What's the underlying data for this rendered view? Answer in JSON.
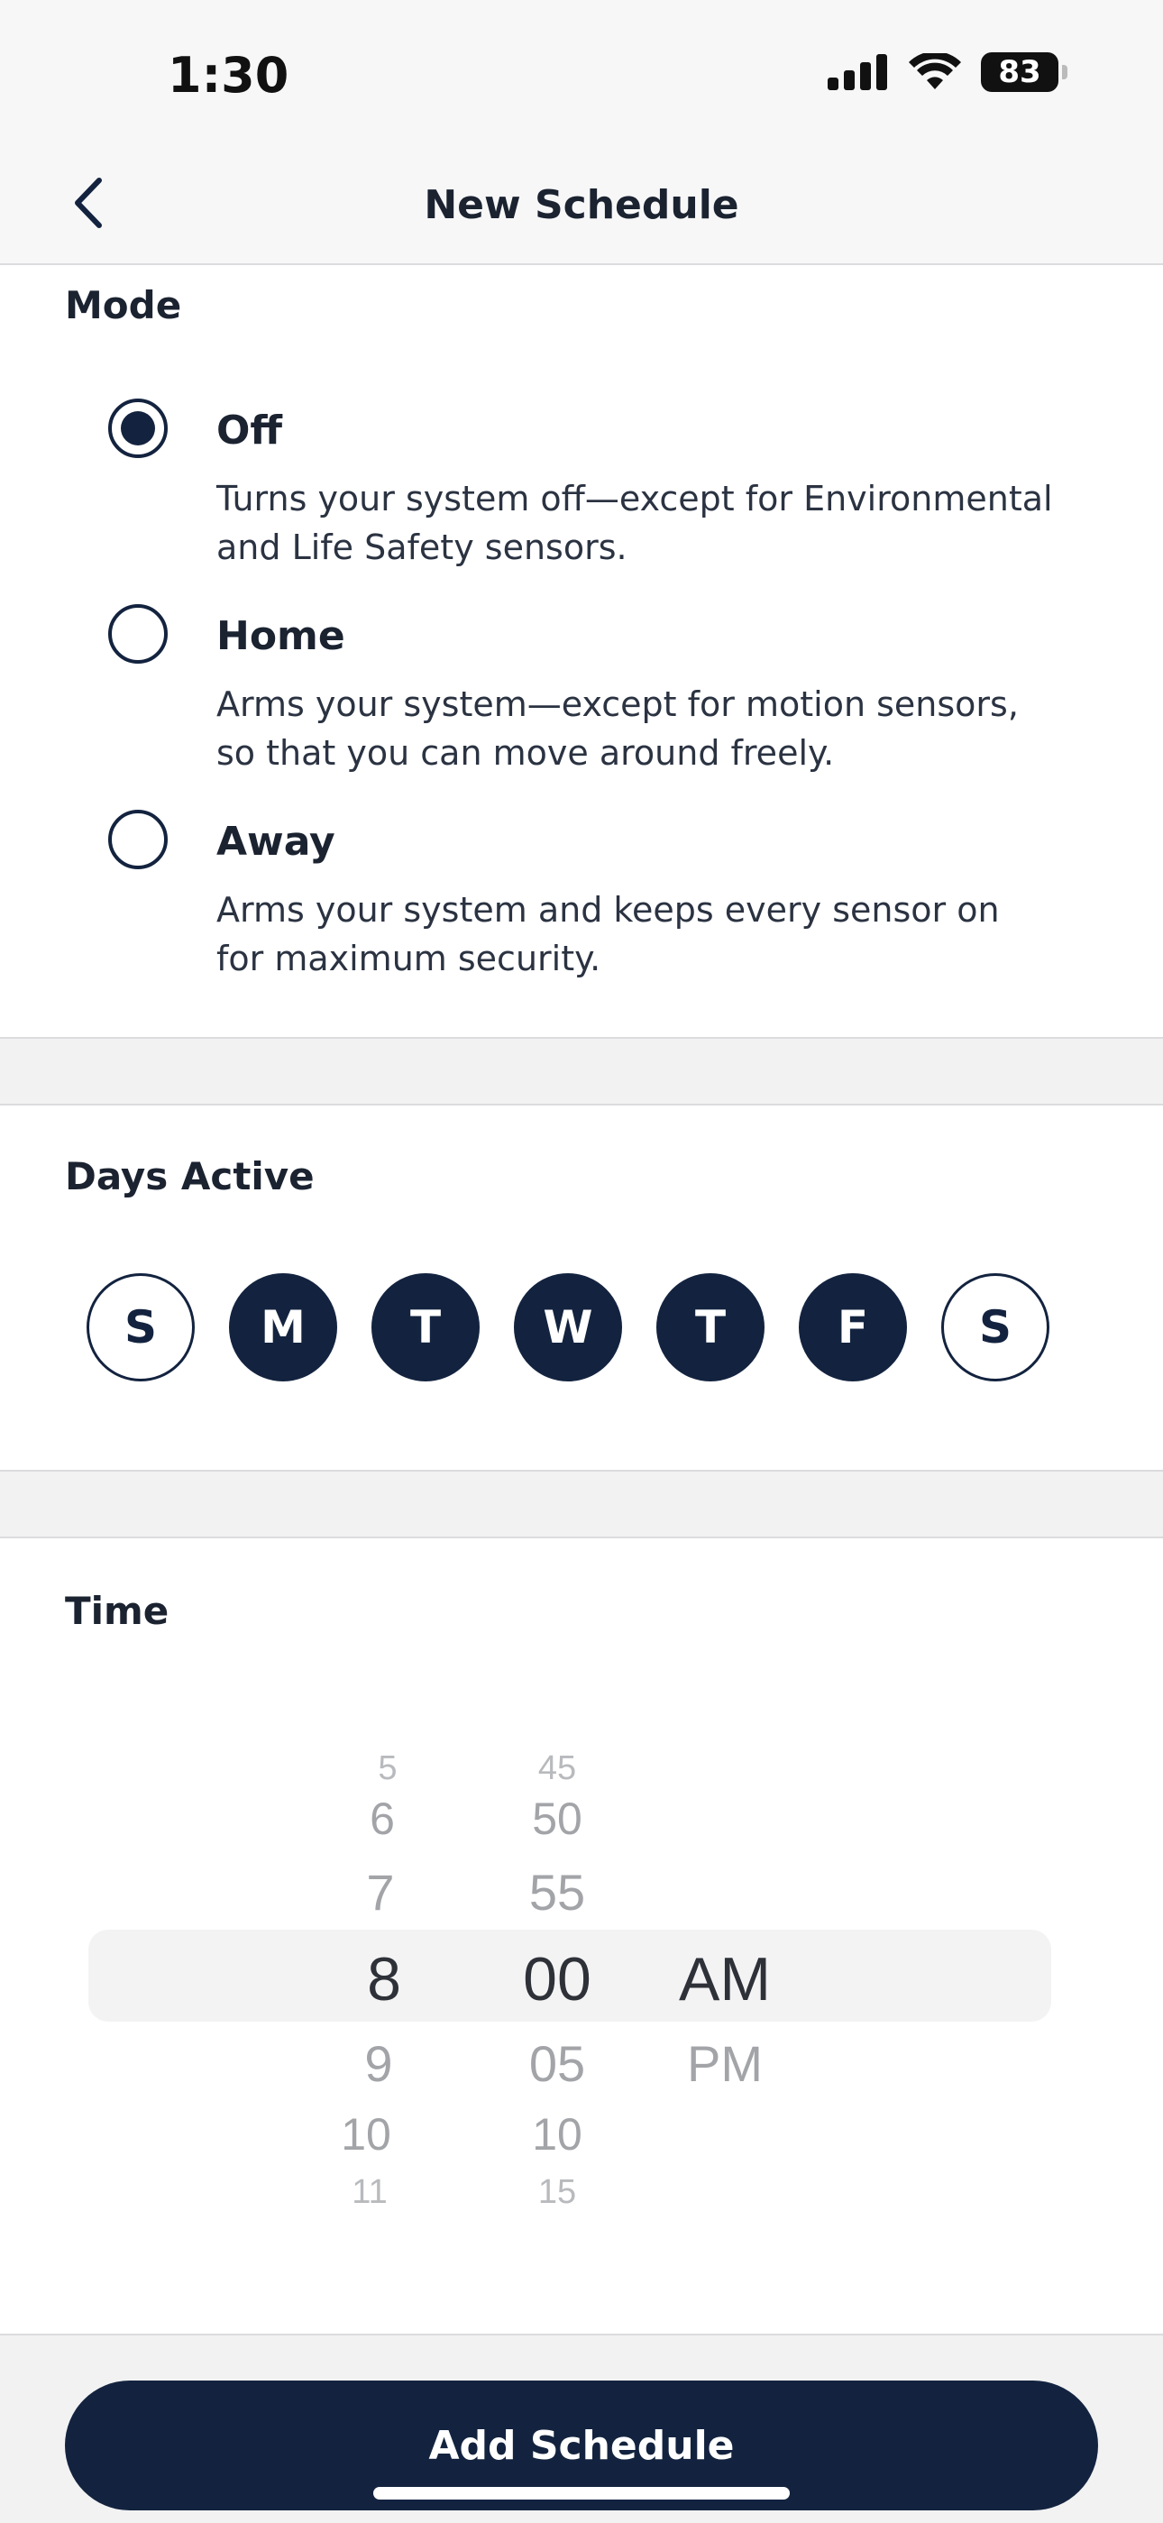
{
  "status_bar": {
    "time": "1:30",
    "battery": "83"
  },
  "header": {
    "title": "New Schedule"
  },
  "mode": {
    "title": "Mode",
    "options": [
      {
        "label": "Off",
        "description": "Turns your system off—except for Environmental and Life Safety sensors.",
        "selected": true
      },
      {
        "label": "Home",
        "description": "Arms your system—except for motion sensors, so that you can move around freely.",
        "selected": false
      },
      {
        "label": "Away",
        "description": "Arms your system and keeps every sensor on for maximum security.",
        "selected": false
      }
    ]
  },
  "days": {
    "title": "Days Active",
    "items": [
      {
        "label": "S",
        "active": false
      },
      {
        "label": "M",
        "active": true
      },
      {
        "label": "T",
        "active": true
      },
      {
        "label": "W",
        "active": true
      },
      {
        "label": "T",
        "active": true
      },
      {
        "label": "F",
        "active": true
      },
      {
        "label": "S",
        "active": false
      }
    ]
  },
  "time": {
    "title": "Time",
    "hours": {
      "above": [
        "5",
        "6",
        "7"
      ],
      "selected": "8",
      "below": [
        "9",
        "10",
        "11"
      ]
    },
    "minutes": {
      "above": [
        "45",
        "50",
        "55"
      ],
      "selected": "00",
      "below": [
        "05",
        "10",
        "15"
      ]
    },
    "period": {
      "selected": "AM",
      "below": [
        "PM"
      ]
    }
  },
  "footer": {
    "button_label": "Add Schedule"
  },
  "colors": {
    "navy": "#13233f",
    "band": "#f2f2f3"
  }
}
